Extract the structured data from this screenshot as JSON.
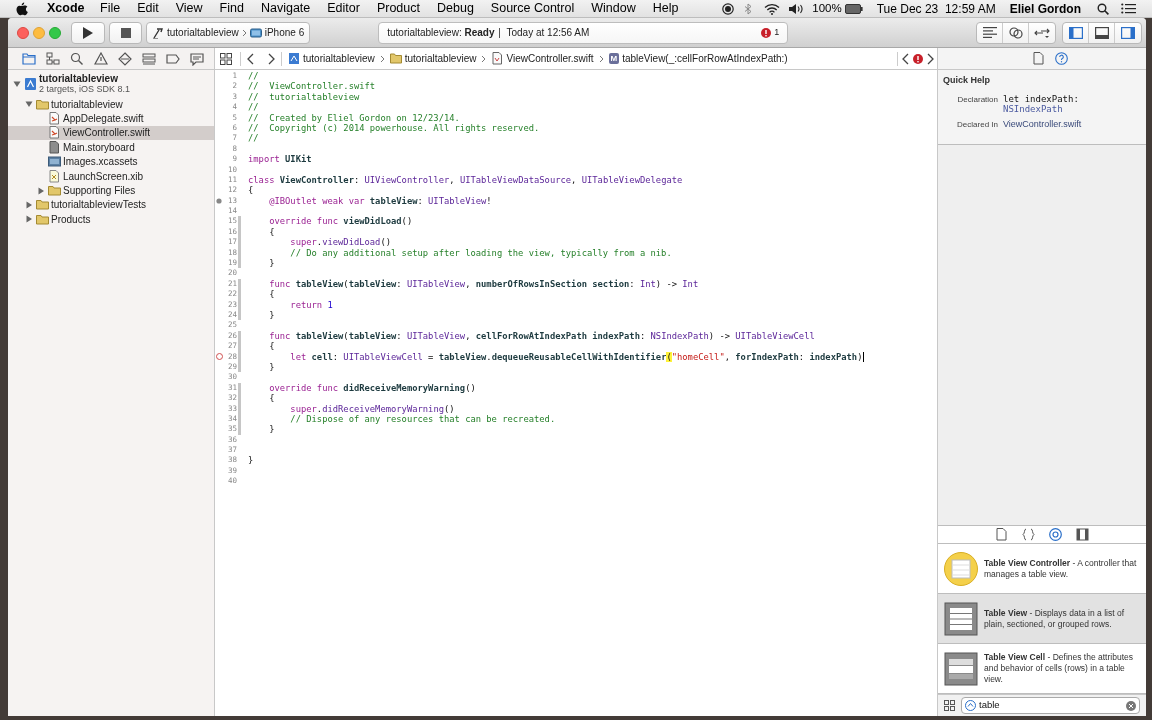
{
  "menubar": {
    "app": "Xcode",
    "menus": [
      "File",
      "Edit",
      "View",
      "Find",
      "Navigate",
      "Editor",
      "Product",
      "Debug",
      "Source Control",
      "Window",
      "Help"
    ],
    "battery": "100%",
    "clock": "Tue Dec 23  12:59 AM",
    "user": "Eliel Gordon"
  },
  "toolbar": {
    "scheme": "tutorialtableview",
    "destination": "iPhone 6",
    "status": "tutorialtableview: **Ready**",
    "timestamp": "Today at 12:56 AM",
    "issue_count": "1"
  },
  "navigator_tabs": [
    {
      "kind": "project",
      "selected": true
    },
    {
      "kind": "symbol",
      "selected": false
    },
    {
      "kind": "find",
      "selected": false
    },
    {
      "kind": "issue",
      "selected": false
    },
    {
      "kind": "test",
      "selected": false
    },
    {
      "kind": "debug",
      "selected": false
    },
    {
      "kind": "breakpoint",
      "selected": false
    },
    {
      "kind": "report",
      "selected": false
    }
  ],
  "navigator": {
    "tree": [
      {
        "kind": "project",
        "label": "tutorialtableview",
        "subtitle": "2 targets, iOS SDK 8.1",
        "expanded": true,
        "selected": false,
        "children": [
          {
            "kind": "group",
            "label": "tutorialtableview",
            "expanded": true,
            "selected": false,
            "children": [
              {
                "kind": "swift",
                "label": "AppDelegate.swift",
                "selected": false
              },
              {
                "kind": "swift",
                "label": "ViewController.swift",
                "selected": true
              },
              {
                "kind": "storyboard",
                "label": "Main.storyboard",
                "selected": false
              },
              {
                "kind": "assets",
                "label": "Images.xcassets",
                "selected": false
              },
              {
                "kind": "xib",
                "label": "LaunchScreen.xib",
                "selected": false
              },
              {
                "kind": "group",
                "label": "Supporting Files",
                "expanded": false,
                "selected": false
              }
            ]
          },
          {
            "kind": "group",
            "label": "tutorialtableviewTests",
            "expanded": false,
            "selected": false
          },
          {
            "kind": "group",
            "label": "Products",
            "expanded": false,
            "selected": false
          }
        ]
      }
    ]
  },
  "jump_bar": {
    "path": [
      {
        "kind": "project",
        "label": "tutorialtableview"
      },
      {
        "kind": "folder",
        "label": "tutorialtableview"
      },
      {
        "kind": "file",
        "label": "ViewController.swift"
      },
      {
        "kind": "method",
        "badge": "M",
        "label": "tableView(_:cellForRowAtIndexPath:)"
      }
    ]
  },
  "editor": {
    "lines": [
      {
        "number": "1",
        "tokens": [
          {
            "kind": "comment",
            "text": "//"
          }
        ]
      },
      {
        "number": "2",
        "tokens": [
          {
            "kind": "comment",
            "text": "//  ViewController.swift"
          }
        ]
      },
      {
        "number": "3",
        "tokens": [
          {
            "kind": "comment",
            "text": "//  tutorialtableview"
          }
        ]
      },
      {
        "number": "4",
        "tokens": [
          {
            "kind": "comment",
            "text": "//"
          }
        ]
      },
      {
        "number": "5",
        "tokens": [
          {
            "kind": "comment",
            "text": "//  Created by Eliel Gordon on 12/23/14."
          }
        ]
      },
      {
        "number": "6",
        "tokens": [
          {
            "kind": "comment",
            "text": "//  Copyright (c) 2014 powerhouse. All rights reserved."
          }
        ]
      },
      {
        "number": "7",
        "tokens": [
          {
            "kind": "comment",
            "text": "//"
          }
        ]
      },
      {
        "number": "8"
      },
      {
        "number": "9",
        "tokens": [
          {
            "kind": "keyword",
            "text": "import "
          },
          {
            "kind": "project",
            "text": "UIKit"
          }
        ]
      },
      {
        "number": "10"
      },
      {
        "number": "11",
        "tokens": [
          {
            "kind": "keyword",
            "text": "class "
          },
          {
            "kind": "project",
            "text": "ViewController"
          },
          {
            "kind": "plain",
            "text": ": "
          },
          {
            "kind": "type",
            "text": "UIViewController"
          },
          {
            "kind": "plain",
            "text": ", "
          },
          {
            "kind": "type",
            "text": "UITableViewDataSource"
          },
          {
            "kind": "plain",
            "text": ", "
          },
          {
            "kind": "type",
            "text": "UITableViewDelegate"
          }
        ]
      },
      {
        "number": "12",
        "tokens": [
          {
            "kind": "plain",
            "text": "{"
          }
        ]
      },
      {
        "number": "13",
        "outlet": true,
        "tokens": [
          {
            "kind": "keyword",
            "text": "    @IBOutlet weak var "
          },
          {
            "kind": "project",
            "text": "tableView"
          },
          {
            "kind": "plain",
            "text": ": "
          },
          {
            "kind": "type",
            "text": "UITableView"
          },
          {
            "kind": "plain",
            "text": "!"
          }
        ]
      },
      {
        "number": "14"
      },
      {
        "number": "15",
        "changed": true,
        "tokens": [
          {
            "kind": "keyword",
            "text": "    override func "
          },
          {
            "kind": "project",
            "text": "viewDidLoad"
          },
          {
            "kind": "plain",
            "text": "()"
          }
        ]
      },
      {
        "number": "16",
        "changed": true,
        "tokens": [
          {
            "kind": "plain",
            "text": "    {"
          }
        ]
      },
      {
        "number": "17",
        "changed": true,
        "tokens": [
          {
            "kind": "keyword",
            "text": "        super"
          },
          {
            "kind": "plain",
            "text": "."
          },
          {
            "kind": "type",
            "text": "viewDidLoad"
          },
          {
            "kind": "plain",
            "text": "()"
          }
        ]
      },
      {
        "number": "18",
        "changed": true,
        "tokens": [
          {
            "kind": "comment",
            "text": "        // Do any additional setup after loading the view, typically from a nib."
          }
        ]
      },
      {
        "number": "19",
        "changed": true,
        "tokens": [
          {
            "kind": "plain",
            "text": "    }"
          }
        ]
      },
      {
        "number": "20"
      },
      {
        "number": "21",
        "changed": true,
        "tokens": [
          {
            "kind": "keyword",
            "text": "    func "
          },
          {
            "kind": "project",
            "text": "tableView"
          },
          {
            "kind": "plain",
            "text": "("
          },
          {
            "kind": "project",
            "text": "tableView"
          },
          {
            "kind": "plain",
            "text": ": "
          },
          {
            "kind": "type",
            "text": "UITableView"
          },
          {
            "kind": "plain",
            "text": ", "
          },
          {
            "kind": "project",
            "text": "numberOfRowsInSection section"
          },
          {
            "kind": "plain",
            "text": ": "
          },
          {
            "kind": "type",
            "text": "Int"
          },
          {
            "kind": "plain",
            "text": ") -> "
          },
          {
            "kind": "type",
            "text": "Int"
          }
        ]
      },
      {
        "number": "22",
        "changed": true,
        "tokens": [
          {
            "kind": "plain",
            "text": "    {"
          }
        ]
      },
      {
        "number": "23",
        "changed": true,
        "tokens": [
          {
            "kind": "keyword",
            "text": "        return "
          },
          {
            "kind": "number",
            "text": "1"
          }
        ]
      },
      {
        "number": "24",
        "changed": true,
        "tokens": [
          {
            "kind": "plain",
            "text": "    }"
          }
        ]
      },
      {
        "number": "25"
      },
      {
        "number": "26",
        "changed": true,
        "tokens": [
          {
            "kind": "keyword",
            "text": "    func "
          },
          {
            "kind": "project",
            "text": "tableView"
          },
          {
            "kind": "plain",
            "text": "("
          },
          {
            "kind": "project",
            "text": "tableView"
          },
          {
            "kind": "plain",
            "text": ": "
          },
          {
            "kind": "type",
            "text": "UITableView"
          },
          {
            "kind": "plain",
            "text": ", "
          },
          {
            "kind": "project",
            "text": "cellForRowAtIndexPath indexPath"
          },
          {
            "kind": "plain",
            "text": ": "
          },
          {
            "kind": "type",
            "text": "NSIndexPath"
          },
          {
            "kind": "plain",
            "text": ") -> "
          },
          {
            "kind": "type",
            "text": "UITableViewCell"
          }
        ]
      },
      {
        "number": "27",
        "changed": true,
        "tokens": [
          {
            "kind": "plain",
            "text": "    {"
          }
        ]
      },
      {
        "number": "28",
        "changed": true,
        "issue": true,
        "cursor": true,
        "tokens": [
          {
            "kind": "keyword",
            "text": "        let "
          },
          {
            "kind": "project",
            "text": "cell"
          },
          {
            "kind": "plain",
            "text": ": "
          },
          {
            "kind": "type",
            "text": "UITableViewCell"
          },
          {
            "kind": "plain",
            "text": " = "
          },
          {
            "kind": "project",
            "text": "tableView"
          },
          {
            "kind": "plain",
            "text": "."
          },
          {
            "kind": "project",
            "text": "dequeueReusableCellWithIdentifier"
          },
          {
            "kind": "match",
            "text": "("
          },
          {
            "kind": "string",
            "text": "\"homeCell\""
          },
          {
            "kind": "plain",
            "text": ", "
          },
          {
            "kind": "project",
            "text": "forIndexPath"
          },
          {
            "kind": "plain",
            "text": ": "
          },
          {
            "kind": "project",
            "text": "indexPath"
          },
          {
            "kind": "plain",
            "text": ")"
          }
        ]
      },
      {
        "number": "29",
        "changed": true,
        "tokens": [
          {
            "kind": "plain",
            "text": "    }"
          }
        ]
      },
      {
        "number": "30"
      },
      {
        "number": "31",
        "changed": true,
        "tokens": [
          {
            "kind": "keyword",
            "text": "    override func "
          },
          {
            "kind": "project",
            "text": "didReceiveMemoryWarning"
          },
          {
            "kind": "plain",
            "text": "()"
          }
        ]
      },
      {
        "number": "32",
        "changed": true,
        "tokens": [
          {
            "kind": "plain",
            "text": "    {"
          }
        ]
      },
      {
        "number": "33",
        "changed": true,
        "tokens": [
          {
            "kind": "keyword",
            "text": "        super"
          },
          {
            "kind": "plain",
            "text": "."
          },
          {
            "kind": "type",
            "text": "didReceiveMemoryWarning"
          },
          {
            "kind": "plain",
            "text": "()"
          }
        ]
      },
      {
        "number": "34",
        "changed": true,
        "tokens": [
          {
            "kind": "comment",
            "text": "        // Dispose of any resources that can be recreated."
          }
        ]
      },
      {
        "number": "35",
        "changed": true,
        "tokens": [
          {
            "kind": "plain",
            "text": "    }"
          }
        ]
      },
      {
        "number": "36"
      },
      {
        "number": "37"
      },
      {
        "number": "38",
        "tokens": [
          {
            "kind": "plain",
            "text": "}"
          }
        ]
      },
      {
        "number": "39"
      },
      {
        "number": "40"
      }
    ]
  },
  "inspector_tabs": [
    {
      "kind": "file",
      "selected": false
    },
    {
      "kind": "help",
      "selected": true
    }
  ],
  "quick_help": {
    "title": "Quick Help",
    "fields": [
      {
        "label": "Declaration",
        "kind": "code",
        "value": "let indexPath:",
        "type_name": "NSIndexPath"
      },
      {
        "label": "Declared In",
        "kind": "link",
        "value": "ViewController.swift"
      }
    ]
  },
  "library": {
    "tabs": [
      {
        "kind": "file",
        "selected": false
      },
      {
        "kind": "snippet",
        "selected": false
      },
      {
        "kind": "object",
        "selected": true
      },
      {
        "kind": "media",
        "selected": false
      }
    ],
    "items": [
      {
        "kind": "controller",
        "text": "**Table View Controller** - A controller that manages a table view.",
        "selected": false
      },
      {
        "kind": "table",
        "text": "**Table View** - Displays data in a list of plain, sectioned, or grouped rows.",
        "selected": true
      },
      {
        "kind": "cell",
        "text": "**Table View Cell** - Defines the attributes and behavior of cells (rows) in a table view.",
        "selected": false
      }
    ],
    "filter": {
      "value": "table"
    }
  }
}
